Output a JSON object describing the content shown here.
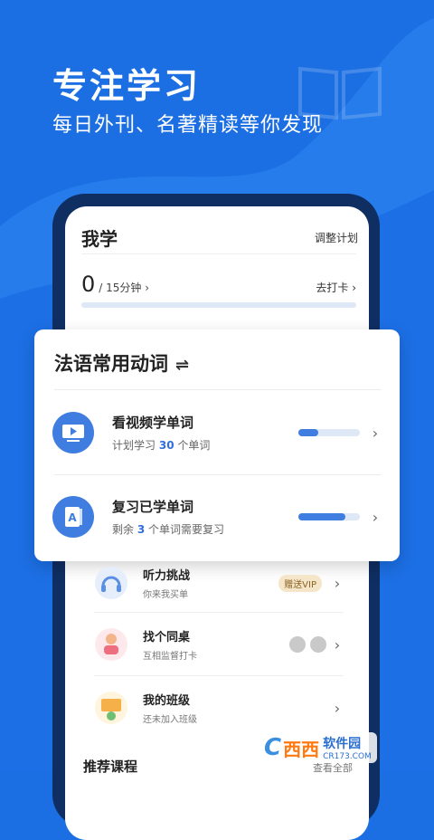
{
  "hero": {
    "title": "专注学习",
    "subtitle": "每日外刊、名著精读等你发现"
  },
  "screen": {
    "title": "我学",
    "adjust_plan": "调整计划",
    "progress_value": "0",
    "progress_unit": "/ 15分钟 ›",
    "checkin": "去打卡 ›",
    "goal_progress": 0
  },
  "card": {
    "title": "法语常用动词",
    "swap_glyph": "⇌",
    "tasks": [
      {
        "name": "看视频学单词",
        "desc_prefix": "计划学习",
        "desc_number": "30",
        "desc_suffix": "个单词",
        "progress": 0.33
      },
      {
        "name": "复习已学单词",
        "desc_prefix": "剩余",
        "desc_number": "3",
        "desc_suffix": "个单词需要复习",
        "progress": 0.77
      }
    ],
    "chevron": "›"
  },
  "list": [
    {
      "name": "听力挑战",
      "desc": "你来我买单",
      "badge": "赠送VIP",
      "icon": "headphones-illustration-icon"
    },
    {
      "name": "找个同桌",
      "desc": "互相监督打卡",
      "icon": "deskmate-illustration-icon"
    },
    {
      "name": "我的班级",
      "desc": "还未加入班级",
      "icon": "class-illustration-icon"
    }
  ],
  "recommend": {
    "title": "推荐课程",
    "see_all": "查看全部"
  },
  "watermark": {
    "logo": "C",
    "name": "西西",
    "brand": "软件园",
    "domain": "CR173.COM"
  },
  "colors": {
    "background": "#1c6fe3",
    "accent": "#3f7de0",
    "phone_frame": "#0f2e62"
  }
}
